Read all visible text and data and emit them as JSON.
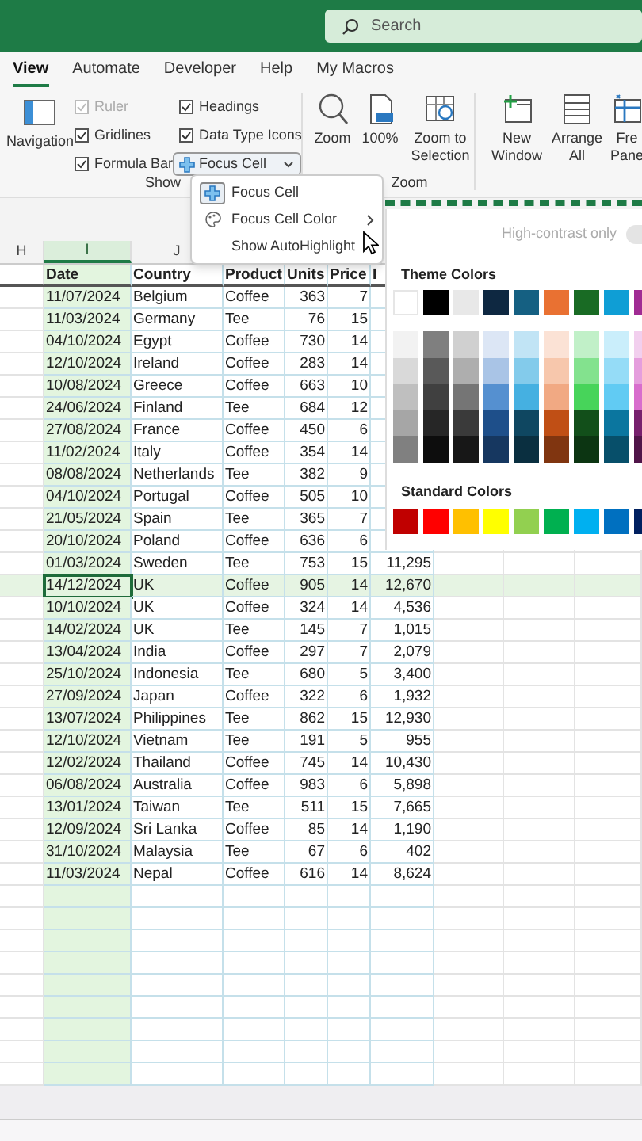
{
  "search": {
    "placeholder": "Search"
  },
  "tabs": [
    {
      "label": "View",
      "selected": true
    },
    {
      "label": "Automate",
      "selected": false
    },
    {
      "label": "Developer",
      "selected": false
    },
    {
      "label": "Help",
      "selected": false
    },
    {
      "label": "My Macros",
      "selected": false
    }
  ],
  "ribbon": {
    "navigation": {
      "label": "Navigation"
    },
    "show_checks": [
      {
        "label": "Ruler",
        "checked": true,
        "disabled": true
      },
      {
        "label": "Gridlines",
        "checked": true,
        "disabled": false
      },
      {
        "label": "Formula Bar",
        "checked": true,
        "disabled": false
      },
      {
        "label": "Headings",
        "checked": true,
        "disabled": false
      },
      {
        "label": "Data Type Icons",
        "checked": true,
        "disabled": false
      }
    ],
    "focus_cell_button": {
      "label": "Focus Cell"
    },
    "show_label": "Show",
    "zoom_buttons": [
      {
        "kind": "zoom",
        "lines": [
          "Zoom"
        ]
      },
      {
        "kind": "percent",
        "lines": [
          "100%"
        ]
      },
      {
        "kind": "selection",
        "lines": [
          "Zoom to",
          "Selection"
        ]
      }
    ],
    "zoom_label": "Zoom",
    "window_buttons": [
      {
        "kind": "newwindow",
        "lines": [
          "New",
          "Window"
        ]
      },
      {
        "kind": "arrange",
        "lines": [
          "Arrange",
          "All"
        ]
      },
      {
        "kind": "freeze",
        "lines": [
          "Fre",
          "Pane"
        ]
      }
    ]
  },
  "menu": {
    "items": [
      {
        "kind": "focus",
        "label": "Focus Cell",
        "on": true,
        "submenu": false
      },
      {
        "kind": "color",
        "label": "Focus Cell Color",
        "on": false,
        "submenu": true
      },
      {
        "kind": "plain",
        "label": "Show AutoHighlight",
        "on": false,
        "submenu": false
      }
    ]
  },
  "palette": {
    "high_contrast": {
      "label": "High-contrast only",
      "on": false
    },
    "theme_label": "Theme Colors",
    "theme_colors": [
      {
        "color": "#ffffff",
        "shades": [
          {
            "color": "#f2f2f2"
          },
          {
            "color": "#d9d9d9"
          },
          {
            "color": "#bfbfbf"
          },
          {
            "color": "#a6a6a6"
          },
          {
            "color": "#808080"
          }
        ]
      },
      {
        "color": "#000000",
        "shades": [
          {
            "color": "#7f7f7f"
          },
          {
            "color": "#595959"
          },
          {
            "color": "#404040"
          },
          {
            "color": "#262626"
          },
          {
            "color": "#0d0d0d"
          }
        ]
      },
      {
        "color": "#e8e8e8",
        "shades": [
          {
            "color": "#d0d0d0"
          },
          {
            "color": "#aeaeae"
          },
          {
            "color": "#757575"
          },
          {
            "color": "#3a3a3a"
          },
          {
            "color": "#171717"
          }
        ]
      },
      {
        "color": "#0e2841",
        "shades": [
          {
            "color": "#dce6f5"
          },
          {
            "color": "#a9c4e6"
          },
          {
            "color": "#5590d0"
          },
          {
            "color": "#1e4f8a"
          },
          {
            "color": "#163760"
          }
        ]
      },
      {
        "color": "#156082",
        "shades": [
          {
            "color": "#c1e4f5"
          },
          {
            "color": "#83cbeb"
          },
          {
            "color": "#45b0e1"
          },
          {
            "color": "#0f4761"
          },
          {
            "color": "#0a2f40"
          }
        ]
      },
      {
        "color": "#e97132",
        "shades": [
          {
            "color": "#fbe2d5"
          },
          {
            "color": "#f7c7ac"
          },
          {
            "color": "#f1a983"
          },
          {
            "color": "#c04f15"
          },
          {
            "color": "#803510"
          }
        ]
      },
      {
        "color": "#196b24",
        "shades": [
          {
            "color": "#c1f0c8"
          },
          {
            "color": "#83e28e"
          },
          {
            "color": "#47d45a"
          },
          {
            "color": "#124f1a"
          },
          {
            "color": "#0c3512"
          }
        ]
      },
      {
        "color": "#0f9ed5",
        "shades": [
          {
            "color": "#caeefb"
          },
          {
            "color": "#95dcf7"
          },
          {
            "color": "#61cbf3"
          },
          {
            "color": "#0b769f"
          },
          {
            "color": "#074f6a"
          }
        ]
      },
      {
        "color": "#a02b93",
        "shades": [
          {
            "color": "#f2cfee"
          },
          {
            "color": "#e59edd"
          },
          {
            "color": "#d86dcd"
          },
          {
            "color": "#77206d"
          },
          {
            "color": "#501549"
          }
        ]
      }
    ],
    "standard_label": "Standard Colors",
    "standard_colors": [
      {
        "color": "#c00000"
      },
      {
        "color": "#ff0000"
      },
      {
        "color": "#ffc000"
      },
      {
        "color": "#ffff00"
      },
      {
        "color": "#92d050"
      },
      {
        "color": "#00b050"
      },
      {
        "color": "#00b0f0"
      },
      {
        "color": "#0070c0"
      },
      {
        "color": "#002060"
      }
    ]
  },
  "sheet": {
    "column_headers": [
      {
        "label": "H",
        "selected": false
      },
      {
        "label": "I",
        "selected": true
      },
      {
        "label": "J",
        "selected": false
      }
    ],
    "table_header": [
      "Date",
      "Country",
      "Product",
      "Units",
      "Price",
      "I"
    ],
    "rows": [
      {
        "selected": false,
        "cells": [
          "11/07/2024",
          "Belgium",
          "Coffee",
          "363",
          "7"
        ]
      },
      {
        "selected": false,
        "cells": [
          "11/03/2024",
          "Germany",
          "Tee",
          "76",
          "15"
        ]
      },
      {
        "selected": false,
        "cells": [
          "04/10/2024",
          "Egypt",
          "Coffee",
          "730",
          "14"
        ]
      },
      {
        "selected": false,
        "cells": [
          "12/10/2024",
          "Ireland",
          "Coffee",
          "283",
          "14"
        ]
      },
      {
        "selected": false,
        "cells": [
          "10/08/2024",
          "Greece",
          "Coffee",
          "663",
          "10"
        ]
      },
      {
        "selected": false,
        "cells": [
          "24/06/2024",
          "Finland",
          "Tee",
          "684",
          "12"
        ]
      },
      {
        "selected": false,
        "cells": [
          "27/08/2024",
          "France",
          "Coffee",
          "450",
          "6"
        ]
      },
      {
        "selected": false,
        "cells": [
          "11/02/2024",
          "Italy",
          "Coffee",
          "354",
          "14"
        ]
      },
      {
        "selected": false,
        "cells": [
          "08/08/2024",
          "Netherlands",
          "Tee",
          "382",
          "9"
        ]
      },
      {
        "selected": false,
        "cells": [
          "04/10/2024",
          "Portugal",
          "Coffee",
          "505",
          "10"
        ]
      },
      {
        "selected": false,
        "cells": [
          "21/05/2024",
          "Spain",
          "Tee",
          "365",
          "7"
        ]
      },
      {
        "selected": false,
        "cells": [
          "20/10/2024",
          "Poland",
          "Coffee",
          "636",
          "6"
        ]
      },
      {
        "selected": false,
        "cells": [
          "01/03/2024",
          "Sweden",
          "Tee",
          "753",
          "15",
          "11,295"
        ]
      },
      {
        "selected": true,
        "cells": [
          "14/12/2024",
          "UK",
          "Coffee",
          "905",
          "14",
          "12,670"
        ]
      },
      {
        "selected": false,
        "cells": [
          "10/10/2024",
          "UK",
          "Coffee",
          "324",
          "14",
          "4,536"
        ]
      },
      {
        "selected": false,
        "cells": [
          "14/02/2024",
          "UK",
          "Tee",
          "145",
          "7",
          "1,015"
        ]
      },
      {
        "selected": false,
        "cells": [
          "13/04/2024",
          "India",
          "Coffee",
          "297",
          "7",
          "2,079"
        ]
      },
      {
        "selected": false,
        "cells": [
          "25/10/2024",
          "Indonesia",
          "Tee",
          "680",
          "5",
          "3,400"
        ]
      },
      {
        "selected": false,
        "cells": [
          "27/09/2024",
          "Japan",
          "Coffee",
          "322",
          "6",
          "1,932"
        ]
      },
      {
        "selected": false,
        "cells": [
          "13/07/2024",
          "Philippines",
          "Tee",
          "862",
          "15",
          "12,930"
        ]
      },
      {
        "selected": false,
        "cells": [
          "12/10/2024",
          "Vietnam",
          "Tee",
          "191",
          "5",
          "955"
        ]
      },
      {
        "selected": false,
        "cells": [
          "12/02/2024",
          "Thailand",
          "Coffee",
          "745",
          "14",
          "10,430"
        ]
      },
      {
        "selected": false,
        "cells": [
          "06/08/2024",
          "Australia",
          "Coffee",
          "983",
          "6",
          "5,898"
        ]
      },
      {
        "selected": false,
        "cells": [
          "13/01/2024",
          "Taiwan",
          "Tee",
          "511",
          "15",
          "7,665"
        ]
      },
      {
        "selected": false,
        "cells": [
          "12/09/2024",
          "Sri Lanka",
          "Coffee",
          "85",
          "14",
          "1,190"
        ]
      },
      {
        "selected": false,
        "cells": [
          "31/10/2024",
          "Malaysia",
          "Tee",
          "67",
          "6",
          "402"
        ]
      },
      {
        "selected": false,
        "cells": [
          "11/03/2024",
          "Nepal",
          "Coffee",
          "616",
          "14",
          "8,624"
        ]
      }
    ]
  }
}
